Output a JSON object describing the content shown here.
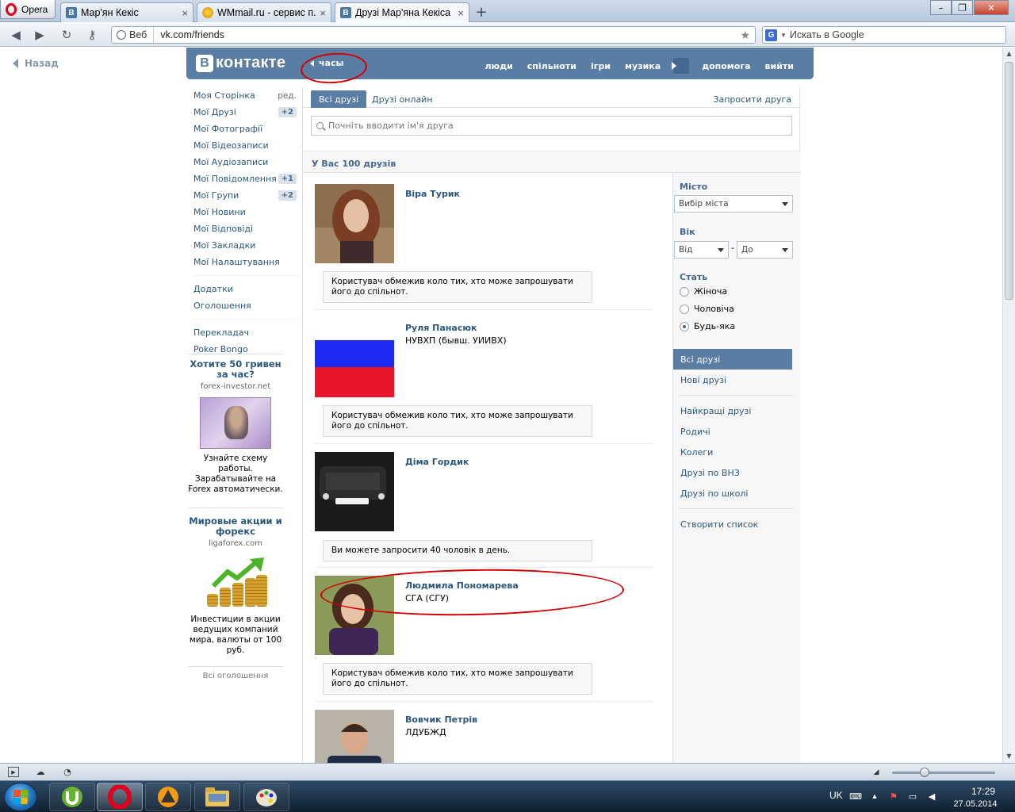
{
  "browser": {
    "menu_label": "Opera",
    "tabs": [
      {
        "label": "Мар'ян Кекіс",
        "icon": "vk-favicon"
      },
      {
        "label": "WMmail.ru - сервис п...",
        "icon": "wmmail-favicon"
      },
      {
        "label": "Друзі Мар'яна Кекіса |...",
        "icon": "vk-favicon",
        "active": true
      }
    ],
    "address": {
      "web_label": "Веб",
      "url": "vk.com/friends"
    },
    "search": {
      "engine": "G",
      "placeholder": "Искать в Google"
    }
  },
  "page": {
    "back_label": "Назад",
    "logo_letter": "В",
    "logo_text": "контакте",
    "player_label": "часы",
    "top_menu": [
      "люди",
      "спільноти",
      "ігри",
      "музика",
      "допомога",
      "вийти"
    ],
    "left_nav": {
      "main": [
        {
          "label": "Моя Сторінка",
          "extra": "ред."
        },
        {
          "label": "Мої Друзі",
          "count": "+2"
        },
        {
          "label": "Мої Фотографії"
        },
        {
          "label": "Мої Відеозаписи"
        },
        {
          "label": "Мої Аудіозаписи"
        },
        {
          "label": "Мої Повідомлення",
          "count": "+1"
        },
        {
          "label": "Мої Групи",
          "count": "+2"
        },
        {
          "label": "Мої Новини"
        },
        {
          "label": "Мої Відповіді"
        },
        {
          "label": "Мої Закладки"
        },
        {
          "label": "Мої Налаштування"
        }
      ],
      "apps": [
        "Додатки",
        "Оголошення"
      ],
      "extras": [
        "Перекладач",
        "Poker Bongo"
      ]
    },
    "ads": [
      {
        "title": "Хотите 50 гривен за час?",
        "domain": "forex-investor.net",
        "text": "Узнайте схему работы. Зарабатывайте на Forex автоматически."
      },
      {
        "title": "Мировые акции и форекс",
        "domain": "ligaforex.com",
        "text": "Инвестиции в акции ведущих компаний мира, валюты от 100 руб."
      }
    ],
    "all_ads_label": "Всі оголошення",
    "content": {
      "tabs": [
        "Всі друзі",
        "Друзі онлайн"
      ],
      "invite_label": "Запросити друга",
      "search_placeholder": "Почніть вводити ім'я друга",
      "count_text": "У Вас 100 друзів",
      "friends": [
        {
          "name": "Віра Турик",
          "sub": "",
          "notice": "Користувач обмежив коло тих, хто може запрошувати його до спільнот."
        },
        {
          "name": "Руля Панасюк",
          "sub": "НУВХП (бывш. УИИВХ)",
          "notice": "Користувач обмежив коло тих, хто може запрошувати його до спільнот."
        },
        {
          "name": "Діма Гордик",
          "sub": "",
          "notice": "Ви можете запросити 40 чоловік в день."
        },
        {
          "name": "Людмила Пономарева",
          "sub": "СГА (СГУ)",
          "notice": "Користувач обмежив коло тих, хто може запрошувати його до спільнот."
        },
        {
          "name": "Вовчик Петрів",
          "sub": "ЛДУБЖД",
          "notice": ""
        }
      ]
    },
    "filters": {
      "city_label": "Місто",
      "city_value": "Вибір міста",
      "age_label": "Вік",
      "age_from": "Від",
      "age_dash": "-",
      "age_to": "До",
      "gender_label": "Стать",
      "gender_options": [
        "Жіноча",
        "Чоловіча",
        "Будь-яка"
      ],
      "gender_selected": "Будь-яка",
      "menu": [
        "Всі друзі",
        "Нові друзі"
      ],
      "menu2": [
        "Найкращі друзі",
        "Родичі",
        "Колеги",
        "Друзі по ВНЗ",
        "Друзі по школі"
      ],
      "create_list": "Створити список"
    }
  },
  "taskbar": {
    "apps": [
      "utorrent",
      "opera",
      "aimp",
      "explorer",
      "paint"
    ],
    "lang": "UK",
    "time": "17:29",
    "date": "27.05.2014"
  },
  "colors": {
    "vk_blue": "#597da3",
    "link": "#2b587a",
    "annotation_red": "#d40000"
  }
}
